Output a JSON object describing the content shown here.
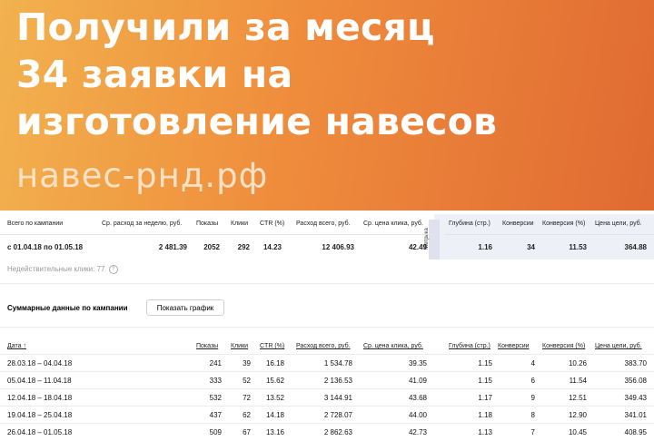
{
  "banner": {
    "headline_lines": [
      "Получили за месяц",
      "34 заявки на",
      "изготовление навесов"
    ],
    "site": "навес-рнд.рф",
    "colors": {
      "gradient_start": "#f2b24e",
      "gradient_end": "#e06a32"
    }
  },
  "summary": {
    "headers": {
      "campaign": "Всего по кампании",
      "weekly": "Ср. расход за неделю, руб.",
      "shows": "Показы",
      "clicks": "Клики",
      "ctr": "CTR (%)",
      "spend": "Расход всего, руб.",
      "cpc": "Ср. цена клика, руб.",
      "metrika": "Метрика",
      "depth": "Глубина (стр.)",
      "conv": "Конверсии",
      "conv_pct": "Конверсия (%)",
      "goal_price": "Цена цели, руб."
    },
    "values": {
      "period": "с 01.04.18 по 01.05.18",
      "weekly": "2 481.39",
      "shows": "2052",
      "clicks": "292",
      "ctr": "14.23",
      "spend": "12 406.93",
      "cpc": "42.49",
      "depth": "1.16",
      "conv": "34",
      "conv_pct": "11.53",
      "goal_price": "364.88"
    },
    "invalid_clicks": "Недействительные клики: 77",
    "help_icon": "?"
  },
  "campaign_summary": {
    "title": "Суммарные данные по кампании",
    "chart_button": "Показать график"
  },
  "table": {
    "headers": [
      "Дата ↑",
      "Показы",
      "Клики",
      "CTR (%)",
      "Расход всего, руб.",
      "Ср. цена клика, руб.",
      "Глубина (стр.)",
      "Конверсии",
      "Конверсия (%)",
      "Цена цели, руб."
    ],
    "rows": [
      [
        "28.03.18 – 04.04.18",
        "241",
        "39",
        "16.18",
        "1 534.78",
        "39.35",
        "1.15",
        "4",
        "10.26",
        "383.70"
      ],
      [
        "05.04.18 – 11.04.18",
        "333",
        "52",
        "15.62",
        "2 136.53",
        "41.09",
        "1.15",
        "6",
        "11.54",
        "356.08"
      ],
      [
        "12.04.18 – 18.04.18",
        "532",
        "72",
        "13.52",
        "3 144.91",
        "43.68",
        "1.17",
        "9",
        "12.51",
        "349.43"
      ],
      [
        "19.04.18 – 25.04.18",
        "437",
        "62",
        "14.18",
        "2 728.07",
        "44.00",
        "1.18",
        "8",
        "12.90",
        "341.01"
      ],
      [
        "26.04.18 – 01.05.18",
        "509",
        "67",
        "13.16",
        "2 862.63",
        "42.73",
        "1.13",
        "7",
        "10.45",
        "408.95"
      ]
    ]
  }
}
